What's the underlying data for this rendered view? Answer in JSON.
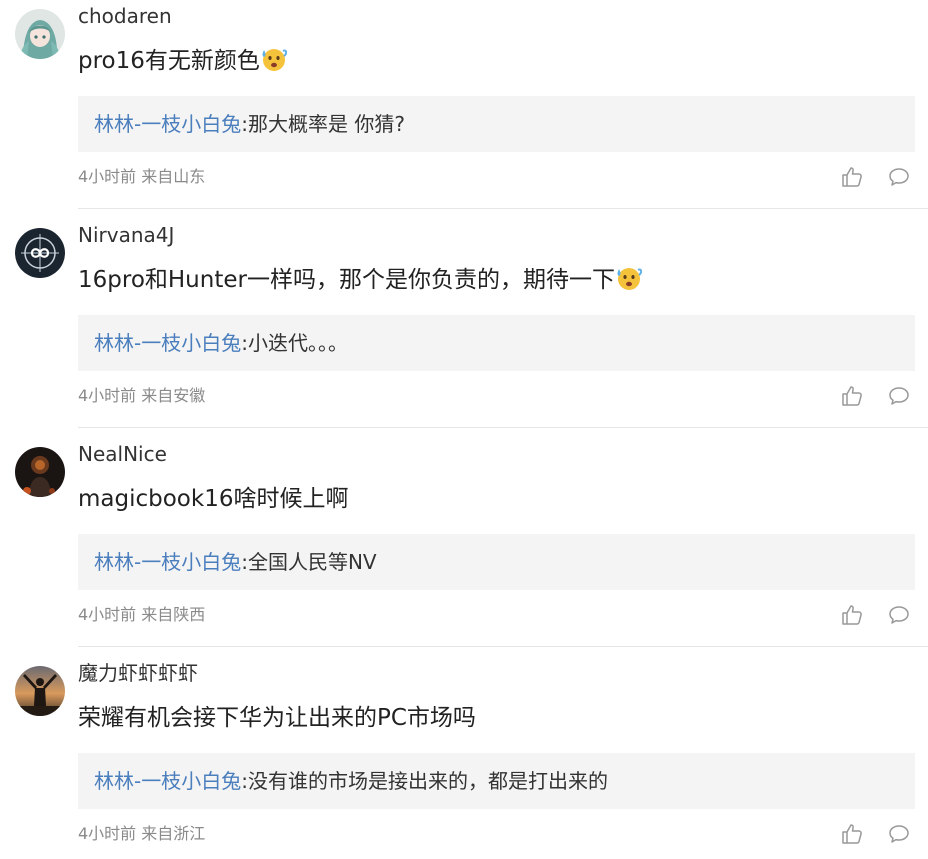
{
  "comments": [
    {
      "username": "chodaren",
      "text": "pro16有无新颜色",
      "emoji": "sweating-face-emoji",
      "reply_author": "林林-一枝小白兔",
      "reply_sep": ":",
      "reply_text": "那大概率是 你猜?",
      "time": "4小时前",
      "location": "来自山东",
      "avatar": "anime-character-avatar"
    },
    {
      "username": "Nirvana4J",
      "text": "16pro和Hunter一样吗，那个是你负责的，期待一下",
      "emoji": "sweating-face-emoji",
      "reply_author": "林林-一枝小白兔",
      "reply_sep": ":",
      "reply_text": "小迭代。。。",
      "time": "4小时前",
      "location": "来自安徽",
      "avatar": "infinity-logo-avatar"
    },
    {
      "username": "NealNice",
      "text": "magicbook16啥时候上啊",
      "emoji": "",
      "reply_author": "林林-一枝小白兔",
      "reply_sep": ":",
      "reply_text": "全国人民等NV",
      "time": "4小时前",
      "location": "来自陕西",
      "avatar": "dark-figure-avatar"
    },
    {
      "username": "魔力虾虾虾虾",
      "text": "荣耀有机会接下华为让出来的PC市场吗",
      "emoji": "",
      "reply_author": "林林-一枝小白兔",
      "reply_sep": ":",
      "reply_text": "没有谁的市场是接出来的，都是打出来的",
      "time": "4小时前",
      "location": "来自浙江",
      "avatar": "sunset-silhouette-avatar"
    }
  ],
  "icons": {
    "like": "thumbs-up-icon",
    "reply": "comment-bubble-icon"
  },
  "colors": {
    "reply_author": "#4a7ebd",
    "reply_bg": "#f4f4f4",
    "meta": "#8a8a8a",
    "divider": "#e6e6e6"
  }
}
